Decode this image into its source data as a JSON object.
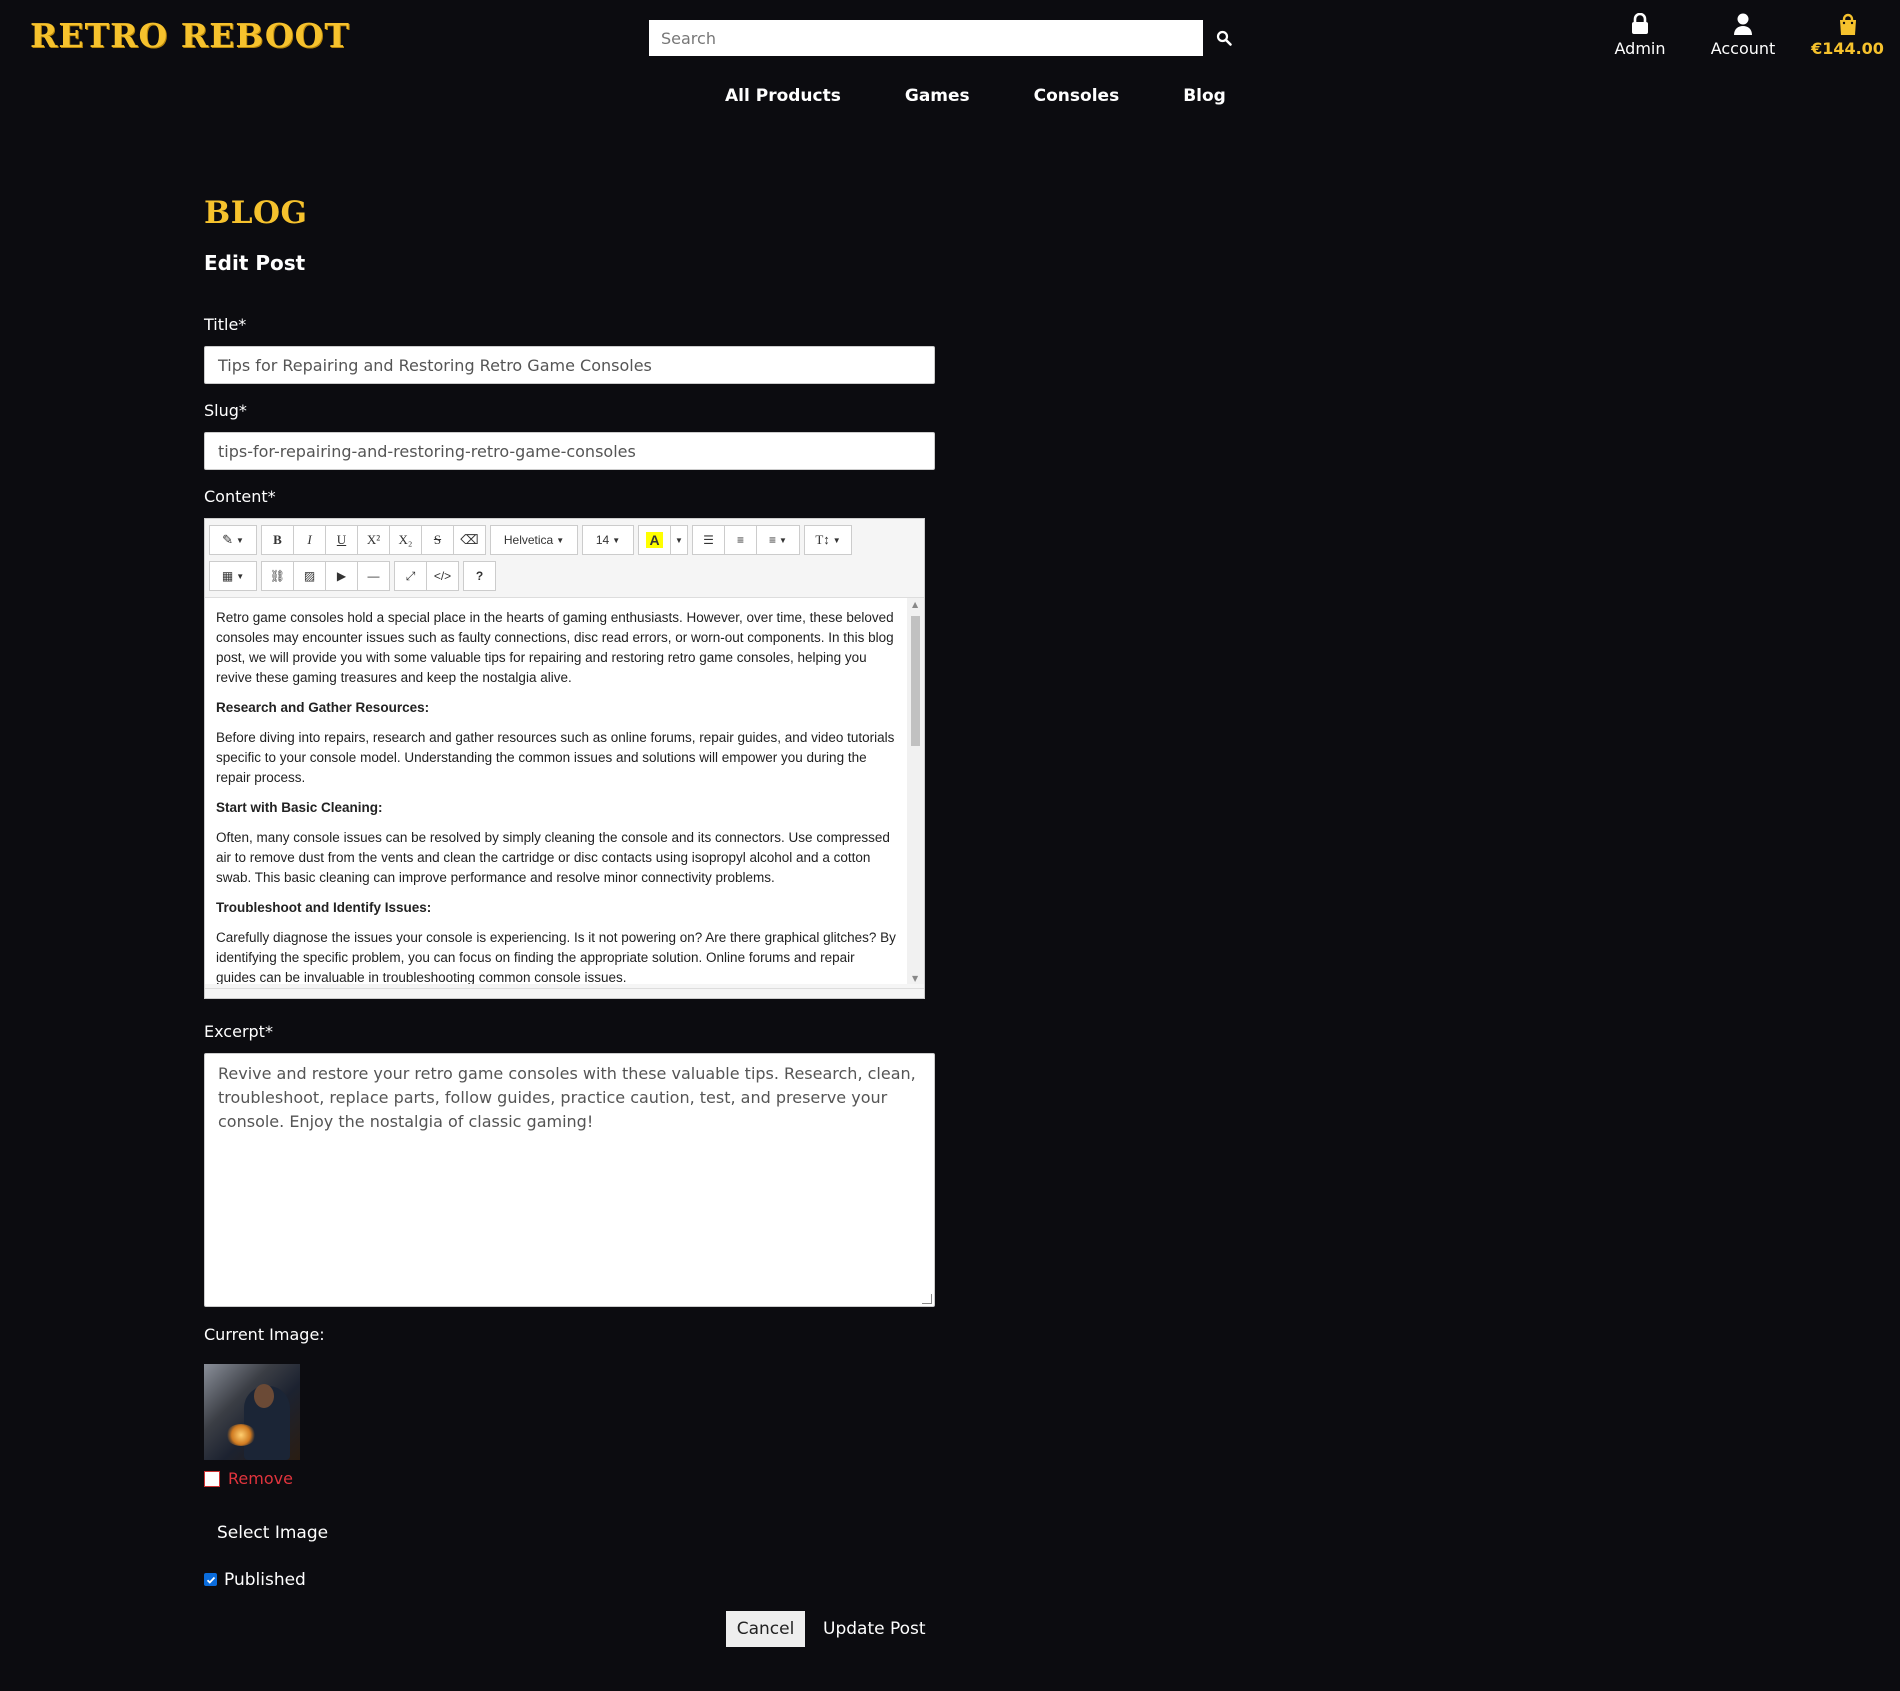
{
  "header": {
    "logo": "RETRO REBOOT",
    "search_placeholder": "Search",
    "admin_label": "Admin",
    "account_label": "Account",
    "bag_total": "€144.00"
  },
  "nav": [
    "All Products",
    "Games",
    "Consoles",
    "Blog"
  ],
  "page": {
    "title": "BLOG",
    "subtitle": "Edit Post"
  },
  "form": {
    "title_label": "Title*",
    "title_value": "Tips for Repairing and Restoring Retro Game Consoles",
    "slug_label": "Slug*",
    "slug_value": "tips-for-repairing-and-restoring-retro-game-consoles",
    "content_label": "Content*",
    "excerpt_label": "Excerpt*",
    "excerpt_value": "Revive and restore your retro game consoles with these valuable tips. Research, clean, troubleshoot, replace parts, follow guides, practice caution, test, and preserve your console. Enjoy the nostalgia of classic gaming!",
    "current_image_label": "Current Image:",
    "remove_label": "Remove",
    "select_image_label": "Select Image",
    "published_label": "Published",
    "published_checked": true,
    "cancel_label": "Cancel",
    "update_label": "Update Post"
  },
  "editor": {
    "font_name": "Helvetica",
    "font_size": "14",
    "toolbar_icons": [
      "magic-icon",
      "bold-icon",
      "italic-icon",
      "underline-icon",
      "superscript-icon",
      "subscript-icon",
      "strikethrough-icon",
      "eraser-icon",
      "highlight-icon",
      "unordered-list-icon",
      "ordered-list-icon",
      "align-icon",
      "line-height-icon",
      "table-icon",
      "link-icon",
      "picture-icon",
      "video-icon",
      "horizontal-rule-icon",
      "fullscreen-icon",
      "code-view-icon",
      "help-icon"
    ],
    "content": [
      {
        "type": "p",
        "text": "Retro game consoles hold a special place in the hearts of gaming enthusiasts. However, over time, these beloved consoles may encounter issues such as faulty connections, disc read errors, or worn-out components. In this blog post, we will provide you with some valuable tips for repairing and restoring retro game consoles, helping you revive these gaming treasures and keep the nostalgia alive."
      },
      {
        "type": "h",
        "text": "Research and Gather Resources:"
      },
      {
        "type": "p",
        "text": "Before diving into repairs, research and gather resources such as online forums, repair guides, and video tutorials specific to your console model. Understanding the common issues and solutions will empower you during the repair process."
      },
      {
        "type": "h",
        "text": "Start with Basic Cleaning:"
      },
      {
        "type": "p",
        "text": "Often, many console issues can be resolved by simply cleaning the console and its connectors. Use compressed air to remove dust from the vents and clean the cartridge or disc contacts using isopropyl alcohol and a cotton swab. This basic cleaning can improve performance and resolve minor connectivity problems."
      },
      {
        "type": "h",
        "text": "Troubleshoot and Identify Issues:"
      },
      {
        "type": "p",
        "text": "Carefully diagnose the issues your console is experiencing. Is it not powering on? Are there graphical glitches? By identifying the specific problem, you can focus on finding the appropriate solution. Online forums and repair guides can be invaluable in troubleshooting common console issues."
      }
    ]
  },
  "colors": {
    "background": "#0c0c10",
    "brand_yellow": "#f6c22d",
    "remove_red": "#e0343d"
  }
}
